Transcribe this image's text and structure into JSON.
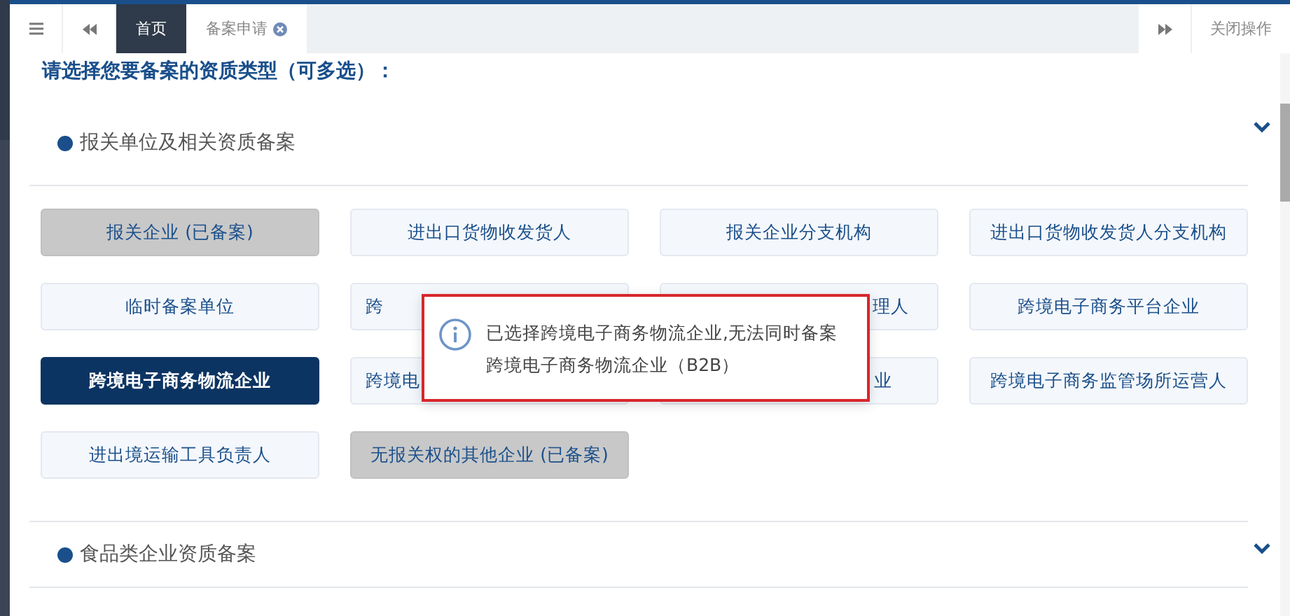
{
  "tabs": [
    {
      "label": "首页",
      "selected": true
    },
    {
      "label": "备案申请",
      "selected": false,
      "closable": true
    }
  ],
  "close_actions": "关闭操作",
  "heading": "请选择您要备案的资质类型（可多选）：",
  "sections": [
    {
      "title": "报关单位及相关资质备案",
      "options": [
        {
          "kind": "full",
          "label": "报关企业 (已备案)",
          "selected": false,
          "registered": true
        },
        {
          "kind": "full",
          "label": "进出口货物收发货人",
          "selected": false,
          "registered": false
        },
        {
          "kind": "full",
          "label": "报关企业分支机构",
          "selected": false,
          "registered": false
        },
        {
          "kind": "full",
          "label": "进出口货物收发货人分支机构",
          "selected": false,
          "registered": false
        },
        {
          "kind": "full",
          "label": "临时备案单位",
          "selected": false,
          "registered": false
        },
        {
          "kind": "head",
          "label": "跨",
          "selected": false,
          "registered": false
        },
        {
          "kind": "tail",
          "label": "理人",
          "selected": false,
          "registered": false
        },
        {
          "kind": "full",
          "label": "跨境电子商务平台企业",
          "selected": false,
          "registered": false
        },
        {
          "kind": "full",
          "label": "跨境电子商务物流企业",
          "selected": true,
          "registered": false
        },
        {
          "kind": "head",
          "label": "跨境电",
          "selected": false,
          "registered": false
        },
        {
          "kind": "tail",
          "label": "业",
          "selected": false,
          "registered": false
        },
        {
          "kind": "full",
          "label": "跨境电子商务监管场所运营人",
          "selected": false,
          "registered": false
        },
        {
          "kind": "full",
          "label": "进出境运输工具负责人",
          "selected": false,
          "registered": false
        },
        {
          "kind": "full",
          "label": "无报关权的其他企业 (已备案)",
          "selected": false,
          "registered": true
        }
      ]
    },
    {
      "title": "食品类企业资质备案"
    }
  ],
  "message": {
    "text": "已选择跨境电子商务物流企业,无法同时备案跨境电子商务物流企业（B2B）"
  }
}
